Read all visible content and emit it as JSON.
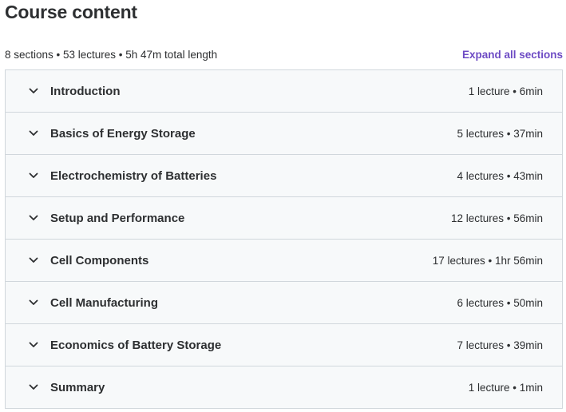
{
  "header": {
    "title": "Course content"
  },
  "summary": {
    "stats": "8 sections • 53 lectures • 5h 47m total length",
    "expand_label": "Expand all sections"
  },
  "colors": {
    "accent": "#6d4bc4",
    "section_bg": "#f7f9fa",
    "border": "#d1d7dc",
    "text": "#2d2f31"
  },
  "sections": [
    {
      "title": "Introduction",
      "meta": "1 lecture • 6min",
      "icon": "chevron-down-icon"
    },
    {
      "title": "Basics of Energy Storage",
      "meta": "5 lectures • 37min",
      "icon": "chevron-down-icon"
    },
    {
      "title": "Electrochemistry of Batteries",
      "meta": "4 lectures • 43min",
      "icon": "chevron-down-icon"
    },
    {
      "title": "Setup and Performance",
      "meta": "12 lectures • 56min",
      "icon": "chevron-down-icon"
    },
    {
      "title": "Cell Components",
      "meta": "17 lectures • 1hr 56min",
      "icon": "chevron-down-icon"
    },
    {
      "title": "Cell Manufacturing",
      "meta": "6 lectures • 50min",
      "icon": "chevron-down-icon"
    },
    {
      "title": "Economics of Battery Storage",
      "meta": "7 lectures • 39min",
      "icon": "chevron-down-icon"
    },
    {
      "title": "Summary",
      "meta": "1 lecture • 1min",
      "icon": "chevron-down-icon"
    }
  ]
}
